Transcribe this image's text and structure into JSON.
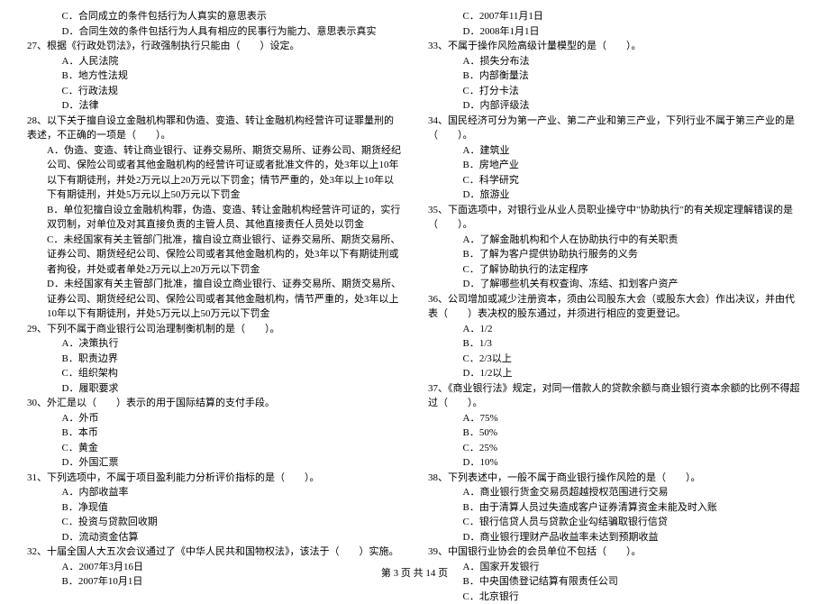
{
  "left": [
    {
      "cls": "indent2",
      "t": "C．合同成立的条件包括行为人真实的意思表示"
    },
    {
      "cls": "indent2",
      "t": "D．合同生效的条件包括行为人具有相应的民事行为能力、意思表示真实"
    },
    {
      "cls": "",
      "t": "27、根据《行政处罚法》，行政强制执行只能由（　　）设定。"
    },
    {
      "cls": "indent2",
      "t": "A．人民法院"
    },
    {
      "cls": "indent2",
      "t": "B．地方性法规"
    },
    {
      "cls": "indent2",
      "t": "C．行政法规"
    },
    {
      "cls": "indent2",
      "t": "D．法律"
    },
    {
      "cls": "",
      "t": "28、以下关于擅自设立金融机构罪和伪造、变造、转让金融机构经营许可证罪量刑的表述，不正确的一项是（　　）。"
    },
    {
      "cls": "indent1",
      "t": "A．伪造、变造、转让商业银行、证券交易所、期货交易所、证券公司、期货经纪公司、保险公司或者其他金融机构的经营许可证或者批准文件的，处3年以上10年以下有期徒刑，并处2万元以上20万元以下罚金；情节严重的，处3年以上10年以下有期徒刑，并处5万元以上50万元以下罚金"
    },
    {
      "cls": "indent1",
      "t": "B．单位犯擅自设立金融机构罪，伪造、变造、转让金融机构经营许可证的，实行双罚制，对单位及对其直接负责的主管人员、其他直接责任人员处以罚金"
    },
    {
      "cls": "indent1",
      "t": "C．未经国家有关主管部门批准，擅自设立商业银行、证券交易所、期货交易所、证券公司、期货经纪公司、保险公司或者其他金融机构的，处3年以下有期徒刑或者拘役，并处或者单处2万元以上20万元以下罚金"
    },
    {
      "cls": "indent1",
      "t": "D．未经国家有关主管部门批准，擅自设立商业银行、证券交易所、期货交易所、证券公司、期货经纪公司、保险公司或者其他金融机构，情节严重的，处3年以上10年以下有期徒刑，并处5万元以上50万元以下罚金"
    },
    {
      "cls": "",
      "t": "29、下列不属于商业银行公司治理制衡机制的是（　　）。"
    },
    {
      "cls": "indent2",
      "t": "A．决策执行"
    },
    {
      "cls": "indent2",
      "t": "B．职责边界"
    },
    {
      "cls": "indent2",
      "t": "C．组织架构"
    },
    {
      "cls": "indent2",
      "t": "D．履职要求"
    },
    {
      "cls": "",
      "t": "30、外汇是以（　　）表示的用于国际结算的支付手段。"
    },
    {
      "cls": "indent2",
      "t": "A．外币"
    },
    {
      "cls": "indent2",
      "t": "B．本币"
    },
    {
      "cls": "indent2",
      "t": "C．黄金"
    },
    {
      "cls": "indent2",
      "t": "D．外国汇票"
    },
    {
      "cls": "",
      "t": "31、下列选项中，不属于项目盈利能力分析评价指标的是（　　）。"
    },
    {
      "cls": "indent2",
      "t": "A．内部收益率"
    },
    {
      "cls": "indent2",
      "t": "B．净现值"
    },
    {
      "cls": "indent2",
      "t": "C．投资与贷款回收期"
    },
    {
      "cls": "indent2",
      "t": "D．流动资金估算"
    },
    {
      "cls": "",
      "t": "32、十届全国人大五次会议通过了《中华人民共和国物权法》，该法于（　　）实施。"
    },
    {
      "cls": "indent2",
      "t": "A．2007年3月16日"
    },
    {
      "cls": "indent2",
      "t": "B．2007年10月1日"
    }
  ],
  "right": [
    {
      "cls": "indent2",
      "t": "C．2007年11月1日"
    },
    {
      "cls": "indent2",
      "t": "D．2008年1月1日"
    },
    {
      "cls": "",
      "t": "33、不属于操作风险高级计量模型的是（　　）。"
    },
    {
      "cls": "indent2",
      "t": "A．损失分布法"
    },
    {
      "cls": "indent2",
      "t": "B．内部衡量法"
    },
    {
      "cls": "indent2",
      "t": "C．打分卡法"
    },
    {
      "cls": "indent2",
      "t": "D．内部评级法"
    },
    {
      "cls": "",
      "t": "34、国民经济可分为第一产业、第二产业和第三产业，下列行业不属于第三产业的是（　　）。"
    },
    {
      "cls": "indent2",
      "t": "A．建筑业"
    },
    {
      "cls": "indent2",
      "t": "B．房地产业"
    },
    {
      "cls": "indent2",
      "t": "C．科学研究"
    },
    {
      "cls": "indent2",
      "t": "D．旅游业"
    },
    {
      "cls": "",
      "t": "35、下面选项中，对银行业从业人员职业操守中\"协助执行\"的有关规定理解错误的是（　　）。"
    },
    {
      "cls": "indent2",
      "t": "A．了解金融机构和个人在协助执行中的有关职责"
    },
    {
      "cls": "indent2",
      "t": "B．了解为客户提供协助执行服务的义务"
    },
    {
      "cls": "indent2",
      "t": "C．了解协助执行的法定程序"
    },
    {
      "cls": "indent2",
      "t": "D．了解哪些机关有权查询、冻结、扣划客户资产"
    },
    {
      "cls": "",
      "t": "36、公司增加或减少注册资本，须由公司股东大会（或股东大会）作出决议，并由代表（　　）表决权的股东通过，并须进行相应的变更登记。"
    },
    {
      "cls": "indent2",
      "t": "A．1/2"
    },
    {
      "cls": "indent2",
      "t": "B．1/3"
    },
    {
      "cls": "indent2",
      "t": "C．2/3以上"
    },
    {
      "cls": "indent2",
      "t": "D．1/2以上"
    },
    {
      "cls": "",
      "t": "37、《商业银行法》规定，对同一借款人的贷款余额与商业银行资本余额的比例不得超过（　　）。"
    },
    {
      "cls": "indent2",
      "t": "A．75%"
    },
    {
      "cls": "indent2",
      "t": "B．50%"
    },
    {
      "cls": "indent2",
      "t": "C．25%"
    },
    {
      "cls": "indent2",
      "t": "D．10%"
    },
    {
      "cls": "",
      "t": "38、下列表述中，一般不属于商业银行操作风险的是（　　）。"
    },
    {
      "cls": "indent2",
      "t": "A．商业银行货金交易员超越授权范围进行交易"
    },
    {
      "cls": "indent2",
      "t": "B．由于清算人员过失造成客户证券清算资金未能及时入账"
    },
    {
      "cls": "indent2",
      "t": "C．银行信贷人员与贷款企业勾结骗取银行信贷"
    },
    {
      "cls": "indent2",
      "t": "D．商业银行理财产品收益率未达到预期收益"
    },
    {
      "cls": "",
      "t": "39、中国银行业协会的会员单位不包括（　　）。"
    },
    {
      "cls": "indent2",
      "t": "A．国家开发银行"
    },
    {
      "cls": "indent2",
      "t": "B．中央国债登记结算有限责任公司"
    },
    {
      "cls": "indent2",
      "t": "C．北京银行"
    }
  ],
  "footer": "第 3 页 共 14 页"
}
